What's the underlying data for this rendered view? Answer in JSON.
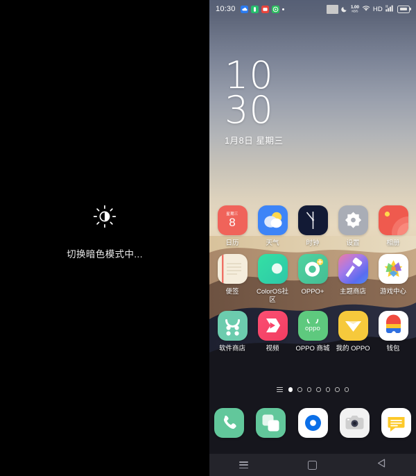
{
  "left_panel": {
    "icon": "brightness-dark-mode-icon",
    "toast_text": "切换暗色模式中...",
    "background": "#000000"
  },
  "phone": {
    "status_bar": {
      "time": "10:30",
      "notification_icons": [
        "cloud-sync-icon",
        "green-app-icon",
        "red-app-icon",
        "green-play-icon",
        "small-dot-icon"
      ],
      "screenshot_indicator": "grey-square-icon",
      "dnd": "moon-icon",
      "net_speed_value": "1.00",
      "net_speed_unit": "KB/S",
      "wifi": "wifi-icon",
      "hd_label": "HD",
      "signal": "signal-bars-icon",
      "battery": "battery-icon"
    },
    "clock_widget": {
      "hours": "10",
      "minutes": "30",
      "date": "1月8日 星期三"
    },
    "rows": [
      [
        {
          "label": "日历",
          "icon": "calendar-icon",
          "color": "#f0635a",
          "badge_top": "星期三",
          "badge_day": "8"
        },
        {
          "label": "天气",
          "icon": "weather-icon",
          "color": "#3d84f7"
        },
        {
          "label": "时钟",
          "icon": "clock-icon",
          "color": "#121a35"
        },
        {
          "label": "设置",
          "icon": "settings-icon",
          "color": "#a9adb6"
        },
        {
          "label": "相册",
          "icon": "album-icon",
          "color": "#ef5a4e"
        }
      ],
      [
        {
          "label": "便签",
          "icon": "notes-icon",
          "color": "#f2ead8"
        },
        {
          "label": "ColorOS社区",
          "icon": "coloros-icon",
          "color": "#3ddc9a"
        },
        {
          "label": "OPPO+",
          "icon": "oppo-plus-icon",
          "color": "#4ecb9a"
        },
        {
          "label": "主题商店",
          "icon": "theme-store-icon",
          "color": "#4f6ef2"
        },
        {
          "label": "游戏中心",
          "icon": "game-center-icon",
          "color": "#ffffff"
        }
      ],
      [
        {
          "label": "软件商店",
          "icon": "app-store-icon",
          "color": "#6cccae"
        },
        {
          "label": "视频",
          "icon": "video-icon",
          "color": "#f8456b"
        },
        {
          "label": "OPPO 商城",
          "icon": "oppo-mall-icon",
          "color": "#5ec97e"
        },
        {
          "label": "我的 OPPO",
          "icon": "my-oppo-icon",
          "color": "#f6c93c"
        },
        {
          "label": "钱包",
          "icon": "wallet-icon",
          "color": "#ffffff"
        }
      ]
    ],
    "page_indicator": {
      "menu_icon": "list-view-icon",
      "total_pages": 7,
      "active_page": 1
    },
    "dock": [
      {
        "label": "电话",
        "icon": "phone-icon",
        "color": "#62c79b"
      },
      {
        "label": "联系人",
        "icon": "contacts-icon",
        "color": "#62c79b"
      },
      {
        "label": "浏览器",
        "icon": "browser-icon",
        "color": "#ffffff"
      },
      {
        "label": "相机",
        "icon": "camera-icon",
        "color": "#f2f2f2"
      },
      {
        "label": "信息",
        "icon": "messages-icon",
        "color": "#ffffff"
      }
    ],
    "nav_bar": [
      {
        "label": "最近任务",
        "icon": "recents-menu-icon"
      },
      {
        "label": "主页",
        "icon": "home-square-icon"
      },
      {
        "label": "返回",
        "icon": "back-triangle-icon"
      }
    ]
  }
}
